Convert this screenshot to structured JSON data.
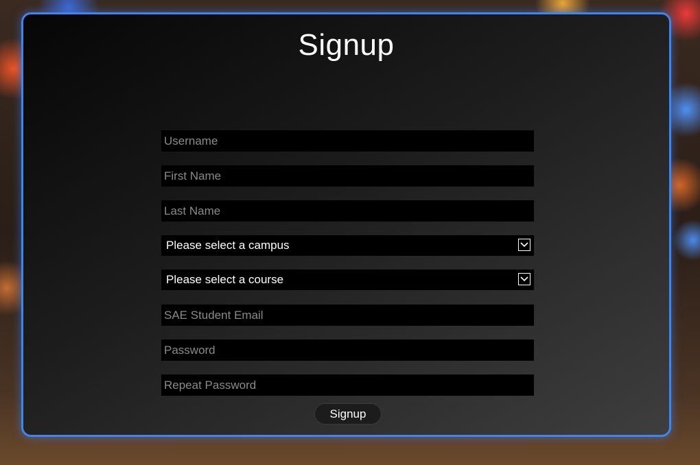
{
  "form": {
    "title": "Signup",
    "fields": {
      "username": {
        "placeholder": "Username",
        "value": ""
      },
      "first_name": {
        "placeholder": "First Name",
        "value": ""
      },
      "last_name": {
        "placeholder": "Last Name",
        "value": ""
      },
      "email": {
        "placeholder": "SAE Student Email",
        "value": ""
      },
      "password": {
        "placeholder": "Password",
        "value": ""
      },
      "repeat_password": {
        "placeholder": "Repeat Password",
        "value": ""
      }
    },
    "selects": {
      "campus": {
        "selected": "Please select a campus",
        "icon": "chevron-down-icon"
      },
      "course": {
        "selected": "Please select a course",
        "icon": "chevron-down-icon"
      }
    },
    "submit_label": "Signup"
  },
  "colors": {
    "accent_border": "#3d86f0",
    "field_bg": "#000000",
    "text": "#ffffff",
    "placeholder": "#8a8a8a"
  }
}
